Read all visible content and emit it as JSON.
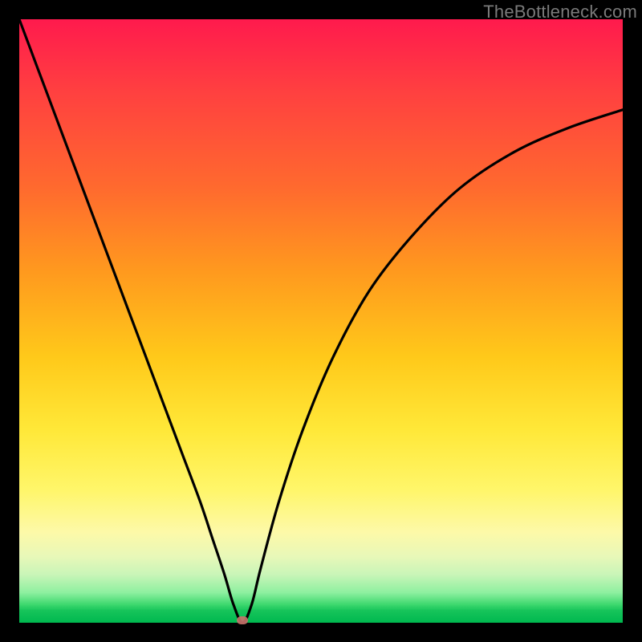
{
  "watermark": "TheBottleneck.com",
  "chart_data": {
    "type": "line",
    "title": "",
    "xlabel": "",
    "ylabel": "",
    "xlim": [
      0,
      100
    ],
    "ylim": [
      0,
      100
    ],
    "legend": false,
    "axes_visible": false,
    "grid": false,
    "description": "Bottleneck curve: V-shaped line over red-to-green vertical gradient. Minimum (optimal point) near x≈37, y≈0.",
    "optimal_point": {
      "x": 37,
      "y": 0
    },
    "series": [
      {
        "name": "bottleneck-curve",
        "x": [
          0,
          3,
          6,
          9,
          12,
          15,
          18,
          21,
          24,
          27,
          30,
          32,
          34,
          35.5,
          37,
          38.5,
          40,
          43,
          47,
          52,
          58,
          65,
          73,
          82,
          91,
          100
        ],
        "values": [
          100,
          92,
          84,
          76,
          68,
          60,
          52,
          44,
          36,
          28,
          20,
          14,
          8,
          3,
          0,
          3,
          9,
          20,
          32,
          44,
          55,
          64,
          72,
          78,
          82,
          85
        ]
      }
    ],
    "background_gradient_stops": [
      {
        "pos": 0,
        "color": "#ff1a4d"
      },
      {
        "pos": 50,
        "color": "#ffb81e"
      },
      {
        "pos": 80,
        "color": "#fff27a"
      },
      {
        "pos": 100,
        "color": "#00b84f"
      }
    ]
  }
}
